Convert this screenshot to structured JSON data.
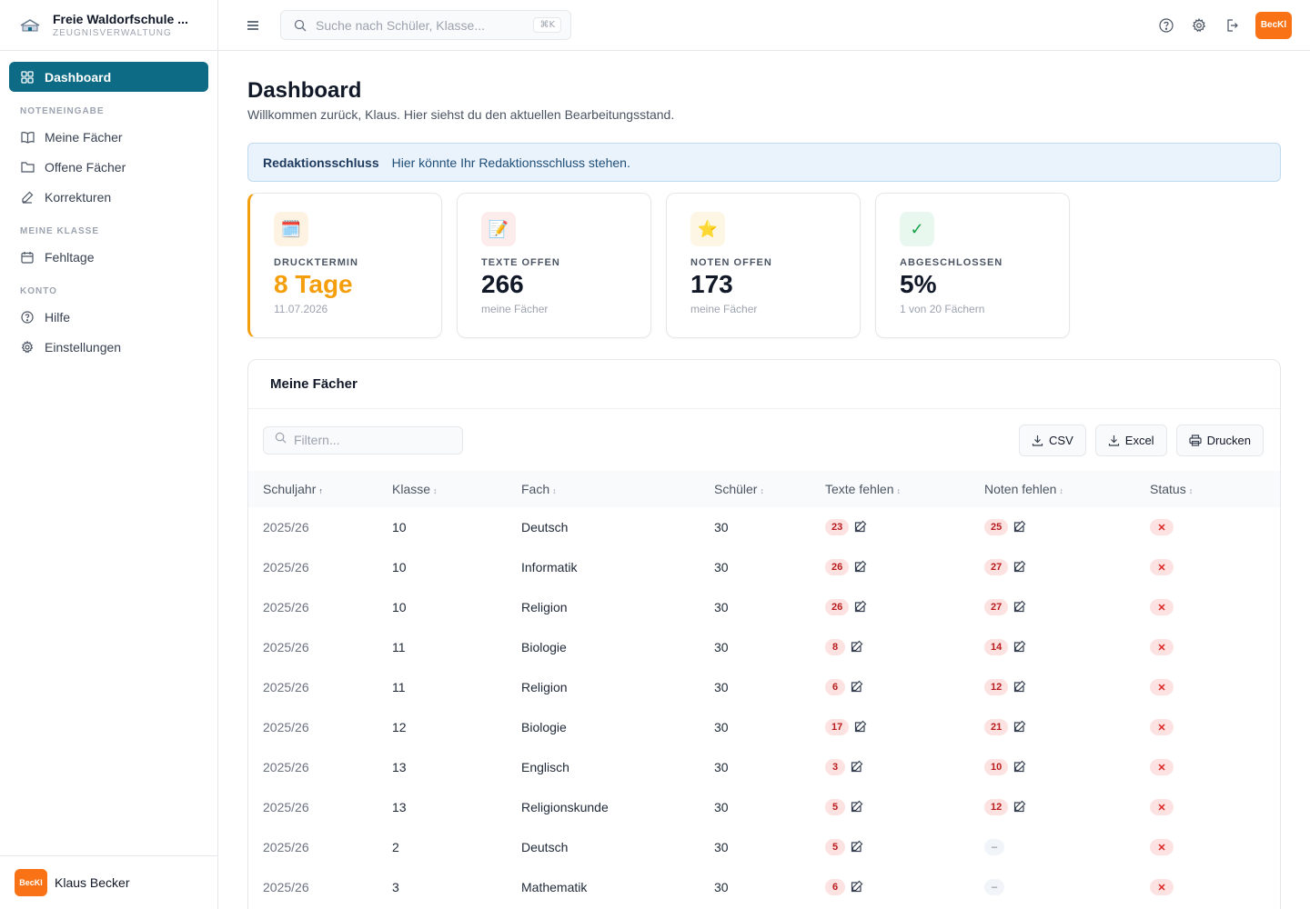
{
  "brand": {
    "title": "Freie Waldorfschule ...",
    "subtitle": "ZEUGNISVERWALTUNG"
  },
  "sidebar": {
    "dashboard": "Dashboard",
    "sections": [
      {
        "title": "NOTENEINGABE",
        "items": [
          "Meine Fächer",
          "Offene Fächer",
          "Korrekturen"
        ]
      },
      {
        "title": "MEINE KLASSE",
        "items": [
          "Fehltage"
        ]
      },
      {
        "title": "KONTO",
        "items": [
          "Hilfe",
          "Einstellungen"
        ]
      }
    ],
    "user": {
      "initials": "BecKl",
      "name": "Klaus Becker"
    }
  },
  "topbar": {
    "search_placeholder": "Suche nach Schüler, Klasse...",
    "shortcut": "⌘K",
    "avatar": "BecKl"
  },
  "page": {
    "title": "Dashboard",
    "subtitle": "Willkommen zurück, Klaus. Hier siehst du den aktuellen Bearbeitungsstand."
  },
  "notice": {
    "title": "Redaktionsschluss",
    "text": "Hier könnte Ihr Redaktionsschluss stehen."
  },
  "stats": [
    {
      "icon": "🗓️",
      "label": "DRUCKTERMIN",
      "value": "8 Tage",
      "note": "11.07.2026"
    },
    {
      "icon": "📝",
      "label": "TEXTE OFFEN",
      "value": "266",
      "note": "meine Fächer"
    },
    {
      "icon": "⭐",
      "label": "NOTEN OFFEN",
      "value": "173",
      "note": "meine Fächer"
    },
    {
      "icon": "✓",
      "label": "ABGESCHLOSSEN",
      "value": "5%",
      "note": "1 von 20 Fächern"
    }
  ],
  "panel": {
    "title": "Meine Fächer",
    "filter_placeholder": "Filtern...",
    "buttons": {
      "csv": "CSV",
      "excel": "Excel",
      "print": "Drucken"
    },
    "columns": [
      "Schuljahr",
      "Klasse",
      "Fach",
      "Schüler",
      "Texte fehlen",
      "Noten fehlen",
      "Status"
    ],
    "rows": [
      {
        "year": "2025/26",
        "class": "10",
        "subject": "Deutsch",
        "students": "30",
        "texts": "23",
        "grades": "25"
      },
      {
        "year": "2025/26",
        "class": "10",
        "subject": "Informatik",
        "students": "30",
        "texts": "26",
        "grades": "27"
      },
      {
        "year": "2025/26",
        "class": "10",
        "subject": "Religion",
        "students": "30",
        "texts": "26",
        "grades": "27"
      },
      {
        "year": "2025/26",
        "class": "11",
        "subject": "Biologie",
        "students": "30",
        "texts": "8",
        "grades": "14"
      },
      {
        "year": "2025/26",
        "class": "11",
        "subject": "Religion",
        "students": "30",
        "texts": "6",
        "grades": "12"
      },
      {
        "year": "2025/26",
        "class": "12",
        "subject": "Biologie",
        "students": "30",
        "texts": "17",
        "grades": "21"
      },
      {
        "year": "2025/26",
        "class": "13",
        "subject": "Englisch",
        "students": "30",
        "texts": "3",
        "grades": "10"
      },
      {
        "year": "2025/26",
        "class": "13",
        "subject": "Religionskunde",
        "students": "30",
        "texts": "5",
        "grades": "12"
      },
      {
        "year": "2025/26",
        "class": "2",
        "subject": "Deutsch",
        "students": "30",
        "texts": "5",
        "grades": "–"
      },
      {
        "year": "2025/26",
        "class": "3",
        "subject": "Mathematik",
        "students": "30",
        "texts": "6",
        "grades": "–"
      }
    ],
    "status_symbol": "✕"
  },
  "colors": {
    "primary": "#0e6b85",
    "accent": "#f59e0b",
    "avatar": "#f97316",
    "danger_bg": "#fde2e2"
  }
}
